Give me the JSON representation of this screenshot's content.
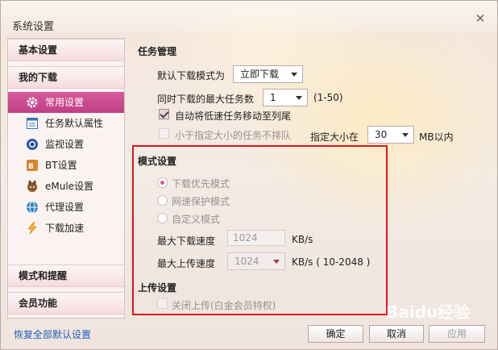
{
  "window": {
    "title": "系统设置",
    "close_symbol": "✕"
  },
  "sidebar": {
    "sections": {
      "basic": "基本设置",
      "my_download": "我的下载",
      "mode_alert": "模式和提醒",
      "member": "会员功能"
    },
    "items": [
      {
        "label": "常用设置",
        "icon": "gear-icon",
        "active": true
      },
      {
        "label": "任务默认属性",
        "icon": "task-list-icon",
        "active": false
      },
      {
        "label": "监视设置",
        "icon": "monitor-eye-icon",
        "active": false
      },
      {
        "label": "BT设置",
        "icon": "bt-icon",
        "active": false
      },
      {
        "label": "eMule设置",
        "icon": "emule-icon",
        "active": false
      },
      {
        "label": "代理设置",
        "icon": "proxy-globe-icon",
        "active": false
      },
      {
        "label": "下载加速",
        "icon": "lightning-icon",
        "active": false
      }
    ],
    "restore_link": "恢复全部默认设置"
  },
  "task_management": {
    "title": "任务管理",
    "default_mode_label": "默认下载模式为",
    "default_mode_value": "立即下载",
    "max_tasks_label": "同时下载的最大任务数",
    "max_tasks_value": "1",
    "max_tasks_range": "(1-50)",
    "auto_move_label": "自动将低速任务移动至列尾",
    "auto_move_checked": true,
    "small_task_label": "小于指定大小的任务不排队",
    "small_task_checked": false,
    "size_label": "指定大小在",
    "size_value": "30",
    "size_unit": "MB以内"
  },
  "mode_settings": {
    "title": "模式设置",
    "options": [
      {
        "label": "下载优先模式",
        "selected": true
      },
      {
        "label": "网速保护模式",
        "selected": false
      },
      {
        "label": "自定义模式",
        "selected": false
      }
    ],
    "max_download_label": "最大下载速度",
    "max_download_value": "1024",
    "max_download_unit": "KB/s",
    "max_upload_label": "最大上传速度",
    "max_upload_value": "1024",
    "max_upload_unit": "KB/s ( 10-2048 )"
  },
  "upload_settings": {
    "title": "上传设置",
    "close_upload_label": "关闭上传(白金会员特权)",
    "close_upload_checked": false
  },
  "buttons": {
    "ok": "确定",
    "cancel": "取消",
    "apply": "应用"
  },
  "watermark": "Baidu经验",
  "colors": {
    "accent": "#c8468c",
    "highlight_border": "#e0141c",
    "link": "#1e5fb8"
  }
}
